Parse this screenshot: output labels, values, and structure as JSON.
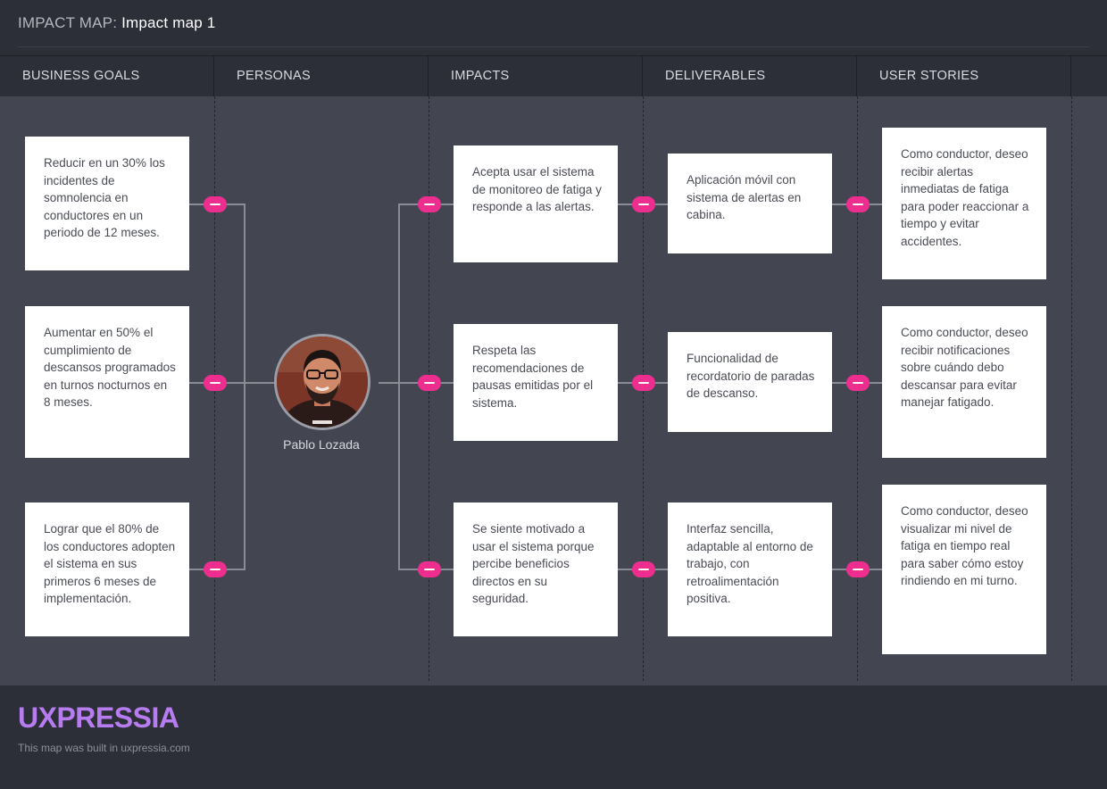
{
  "header": {
    "prefix": "IMPACT MAP:",
    "map_name": "Impact map 1"
  },
  "columns": [
    {
      "label": "BUSINESS GOALS"
    },
    {
      "label": "PERSONAS"
    },
    {
      "label": "IMPACTS"
    },
    {
      "label": "DELIVERABLES"
    },
    {
      "label": "USER STORIES"
    }
  ],
  "business_goals": [
    {
      "text": "Reducir en un 30% los incidentes de somnolencia en conductores en un periodo de 12 meses."
    },
    {
      "text": "Aumentar en 50% el cumplimiento de descansos programados en turnos nocturnos en 8 meses."
    },
    {
      "text": "Lograr que el 80% de los conductores adopten el sistema en sus primeros 6 meses de implementación."
    }
  ],
  "persona": {
    "name": "Pablo Lozada"
  },
  "impacts": [
    {
      "text": "Acepta usar el sistema de monitoreo de fatiga y responde a las alertas."
    },
    {
      "text": "Respeta las recomendaciones de pausas emitidas por el sistema."
    },
    {
      "text": "Se siente motivado a usar el sistema porque percibe beneficios directos en su seguridad."
    }
  ],
  "deliverables": [
    {
      "text": "Aplicación móvil con sistema de alertas en cabina."
    },
    {
      "text": "Funcionalidad de recordatorio de paradas de descanso."
    },
    {
      "text": "Interfaz sencilla, adaptable al entorno de trabajo, con retroalimentación positiva."
    }
  ],
  "user_stories": [
    {
      "text": "Como conductor, deseo recibir alertas inmediatas de fatiga para poder reaccionar a tiempo y evitar accidentes."
    },
    {
      "text": "Como conductor, deseo recibir notificaciones sobre cuándo debo descansar para evitar manejar fatigado."
    },
    {
      "text": "Como conductor, deseo visualizar mi nivel de fatiga en tiempo real para saber cómo estoy rindiendo en mi turno."
    }
  ],
  "footer": {
    "brand": "UXPRESSIA",
    "built_in": "This map was built in uxpressia.com"
  },
  "colors": {
    "accent": "#ee2e8e",
    "brand": "#b67cf0",
    "canvas": "#434651",
    "header": "#2d2f38"
  }
}
